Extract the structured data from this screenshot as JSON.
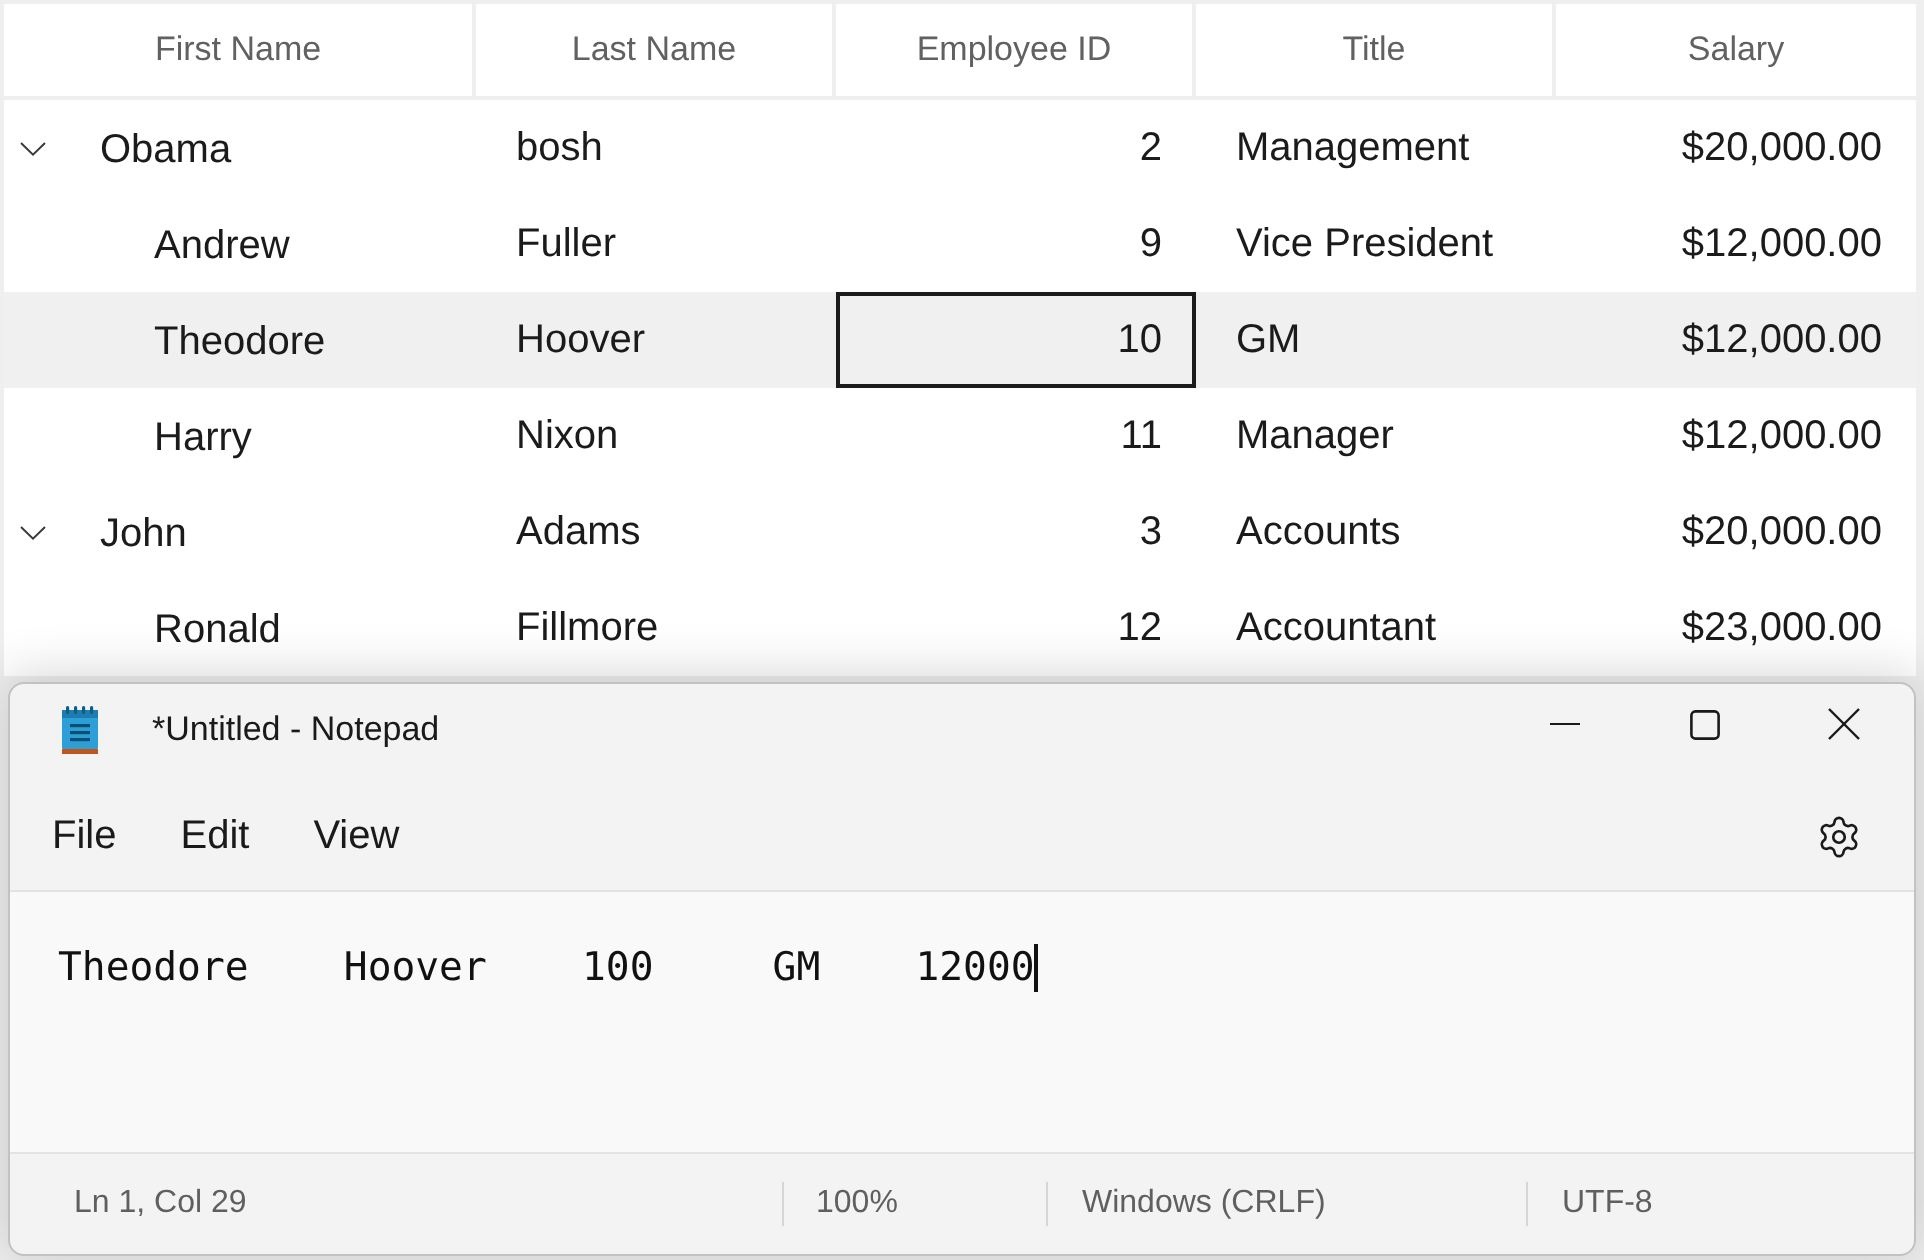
{
  "grid": {
    "columns": [
      {
        "label": "First Name",
        "kind": "text"
      },
      {
        "label": "Last Name",
        "kind": "text"
      },
      {
        "label": "Employee ID",
        "kind": "number"
      },
      {
        "label": "Title",
        "kind": "text"
      },
      {
        "label": "Salary",
        "kind": "number"
      }
    ],
    "rows": [
      {
        "cells": [
          {
            "text": "Obama",
            "focused": false
          },
          {
            "text": "bosh",
            "focused": false
          },
          {
            "text": "2",
            "focused": false
          },
          {
            "text": "Management",
            "focused": false
          },
          {
            "text": "$20,000.00",
            "focused": false
          }
        ],
        "selected": false,
        "expanded": true,
        "children": [
          {
            "cells": [
              {
                "text": "Andrew",
                "focused": false
              },
              {
                "text": "Fuller",
                "focused": false
              },
              {
                "text": "9",
                "focused": false
              },
              {
                "text": "Vice President",
                "focused": false
              },
              {
                "text": "$12,000.00",
                "focused": false
              }
            ],
            "selected": false
          },
          {
            "cells": [
              {
                "text": "Theodore",
                "focused": false
              },
              {
                "text": "Hoover",
                "focused": false
              },
              {
                "text": "10",
                "focused": true
              },
              {
                "text": "GM",
                "focused": false
              },
              {
                "text": "$12,000.00",
                "focused": false
              }
            ],
            "selected": true
          },
          {
            "cells": [
              {
                "text": "Harry",
                "focused": false
              },
              {
                "text": "Nixon",
                "focused": false
              },
              {
                "text": "11",
                "focused": false
              },
              {
                "text": "Manager",
                "focused": false
              },
              {
                "text": "$12,000.00",
                "focused": false
              }
            ],
            "selected": false
          }
        ]
      },
      {
        "cells": [
          {
            "text": "John",
            "focused": false
          },
          {
            "text": "Adams",
            "focused": false
          },
          {
            "text": "3",
            "focused": false
          },
          {
            "text": "Accounts",
            "focused": false
          },
          {
            "text": "$20,000.00",
            "focused": false
          }
        ],
        "selected": false,
        "expanded": true,
        "children": [
          {
            "cells": [
              {
                "text": "Ronald",
                "focused": false
              },
              {
                "text": "Fillmore",
                "focused": false
              },
              {
                "text": "12",
                "focused": false
              },
              {
                "text": "Accountant",
                "focused": false
              },
              {
                "text": "$23,000.00",
                "focused": false
              }
            ],
            "selected": false
          }
        ]
      }
    ]
  },
  "notepad": {
    "title": "*Untitled - Notepad",
    "menu": [
      "File",
      "Edit",
      "View"
    ],
    "text": "Theodore    Hoover    100     GM    12000",
    "status_bar": [
      "Ln 1, Col 29",
      "100%",
      "Windows (CRLF)",
      "UTF-8"
    ]
  }
}
